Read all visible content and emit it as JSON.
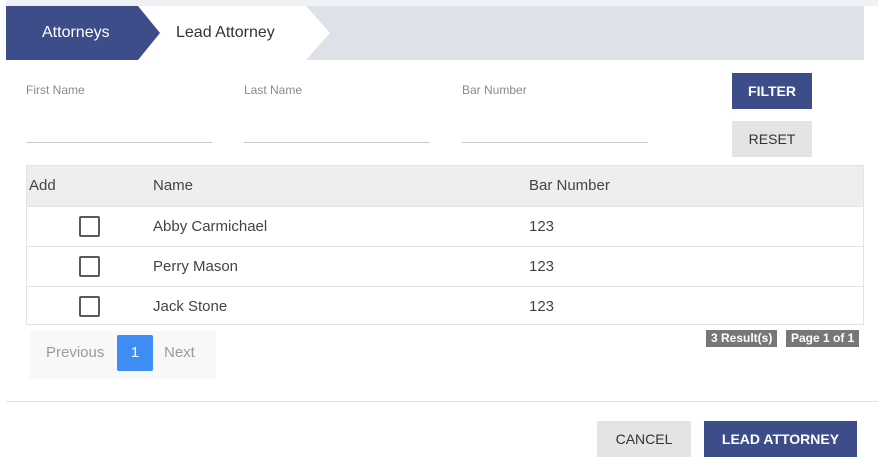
{
  "tabs": [
    {
      "label": "Attorneys",
      "active": true
    },
    {
      "label": "Lead Attorney",
      "active": false
    }
  ],
  "filters": {
    "first_name_label": "First Name",
    "first_name_value": "",
    "last_name_label": "Last Name",
    "last_name_value": "",
    "bar_number_label": "Bar Number",
    "bar_number_value": "",
    "filter_button": "FILTER",
    "reset_button": "RESET"
  },
  "table": {
    "headers": {
      "add": "Add",
      "name": "Name",
      "bar_number": "Bar Number"
    },
    "rows": [
      {
        "checked": false,
        "name": "Abby Carmichael",
        "bar_number": "123"
      },
      {
        "checked": false,
        "name": "Perry Mason",
        "bar_number": "123"
      },
      {
        "checked": false,
        "name": "Jack Stone",
        "bar_number": "123"
      }
    ]
  },
  "results": {
    "count": "3 Result(s)",
    "page": "Page 1 of 1"
  },
  "pagination": {
    "previous": "Previous",
    "current": "1",
    "next": "Next"
  },
  "footer": {
    "cancel": "CANCEL",
    "lead_attorney": "LEAD ATTORNEY"
  },
  "colors": {
    "primary": "#3d4d8a",
    "page_active": "#3d8df5",
    "badge": "#777777"
  }
}
